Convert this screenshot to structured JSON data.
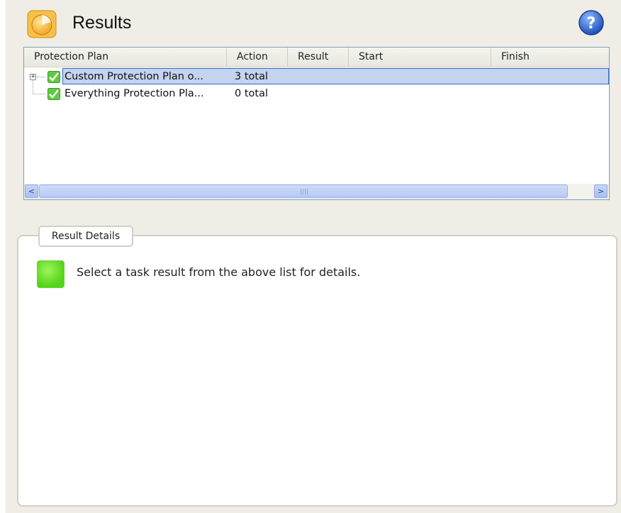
{
  "header": {
    "title": "Results",
    "icon": "results-pie-icon",
    "help_icon": "help-icon"
  },
  "list": {
    "columns": [
      "Protection Plan",
      "Action",
      "Result",
      "Start",
      "Finish"
    ],
    "rows": [
      {
        "plan": "Custom Protection Plan o...",
        "action": "3 total",
        "result": "",
        "start": "",
        "finish": "",
        "expanded": false,
        "selected": true
      },
      {
        "plan": "Everything Protection Pla...",
        "action": "0 total",
        "result": "",
        "start": "",
        "finish": "",
        "selected": false
      }
    ],
    "scroll_left": "<",
    "scroll_right": ">"
  },
  "details": {
    "legend": "Result Details",
    "message": "Select a task result from the above list for details."
  },
  "colors": {
    "selection_fill": "#c4d3ee",
    "selection_border": "#316ac5",
    "status_green": "#54d418",
    "help_blue": "#2a63c9"
  }
}
